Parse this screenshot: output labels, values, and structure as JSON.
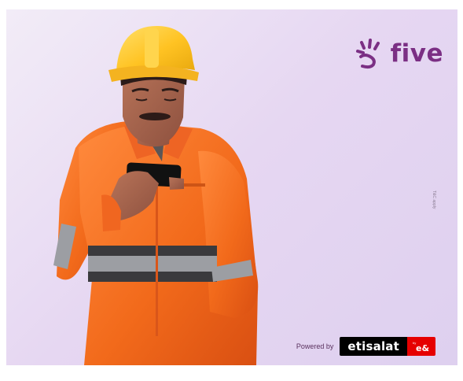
{
  "brand": {
    "name": "five",
    "color": "#7b2f84"
  },
  "vertical_note": {
    "text": "T&C apply"
  },
  "footer": {
    "powered_by": "Powered by",
    "partner_name": "etisalat",
    "partner_parent": "by e&"
  },
  "colors": {
    "background": "#e6d7f2",
    "coverall": "#f26a1b",
    "helmet": "#ffc323",
    "partner_red": "#e60000"
  }
}
